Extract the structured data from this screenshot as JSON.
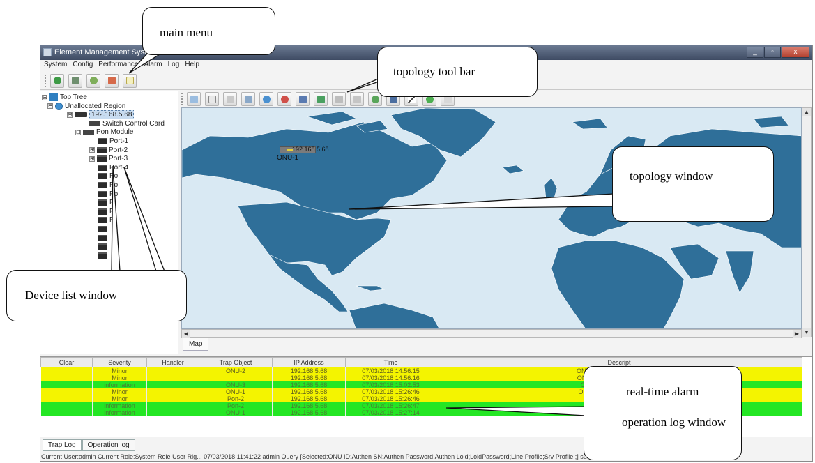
{
  "window": {
    "title": "Element Management System",
    "controls": [
      "_",
      "▫",
      "x"
    ]
  },
  "menu": [
    "System",
    "Config",
    "Performance",
    "Alarm",
    "Log",
    "Help"
  ],
  "tree": [
    {
      "label": "Top Tree",
      "expander": "⊟",
      "icon": "top-tree-icon"
    },
    {
      "label": "Unallocated Region",
      "expander": "⊟",
      "icon": "globe-icon"
    },
    {
      "label": "192.168.5.68",
      "expander": "⊟",
      "icon": "olt-device-icon",
      "selected": true
    },
    {
      "label": "Switch Control Card",
      "expander": "",
      "icon": "card-icon"
    },
    {
      "label": "Pon Module",
      "expander": "⊟",
      "icon": "card-icon"
    },
    {
      "label": "Port-1",
      "expander": "",
      "icon": "port-icon"
    },
    {
      "label": "Port-2",
      "expander": "⊞",
      "icon": "port-icon"
    },
    {
      "label": "Port-3",
      "expander": "⊞",
      "icon": "port-icon"
    },
    {
      "label": "Port-4",
      "expander": "",
      "icon": "port-icon"
    },
    {
      "label": "Po",
      "expander": "",
      "icon": "port-icon"
    },
    {
      "label": "Po",
      "expander": "",
      "icon": "port-icon"
    },
    {
      "label": "Po",
      "expander": "",
      "icon": "port-icon"
    },
    {
      "label": "P",
      "expander": "",
      "icon": "port-icon"
    },
    {
      "label": "P",
      "expander": "",
      "icon": "port-icon"
    },
    {
      "label": "P",
      "expander": "",
      "icon": "port-icon"
    },
    {
      "label": "",
      "expander": "",
      "icon": "port-icon"
    },
    {
      "label": "",
      "expander": "",
      "icon": "port-icon"
    },
    {
      "label": "",
      "expander": "",
      "icon": "port-icon"
    },
    {
      "label": "",
      "expander": "",
      "icon": "port-icon"
    }
  ],
  "topology": {
    "device_ip": "192.168.5.68",
    "device_label": "ONU-1",
    "tab": "Map"
  },
  "alarm_table": {
    "columns": [
      "Clear",
      "Severity",
      "Handler",
      "Trap Object",
      "IP Address",
      "Time",
      "Descript"
    ],
    "rows": [
      {
        "color": "yellow",
        "cells": [
          "",
          "Minor",
          "",
          "ONU-2",
          "192.168.5.68",
          "07/03/2018 14:56:15",
          "ONU DeRegistered(PON Card"
        ]
      },
      {
        "color": "yellow",
        "cells": [
          "",
          "Minor",
          "",
          "",
          "192.168.5.68",
          "07/03/2018 14:56:16",
          "ONU loss Of frame(PON Card"
        ]
      },
      {
        "color": "green",
        "cells": [
          "",
          "information",
          "",
          "ONU-3",
          "192.168.5.68",
          "07/03/2018 15:02:53",
          "ONU Registered(PON Card"
        ]
      },
      {
        "color": "yellow",
        "cells": [
          "",
          "Minor",
          "",
          "ONU-1",
          "192.168.5.68",
          "07/03/2018 15:26:46",
          "ONU DeRegistered(PON Car"
        ]
      },
      {
        "color": "yellow",
        "cells": [
          "",
          "Minor",
          "",
          "Pon-2",
          "192.168.5.68",
          "07/03/2018 15:26:46",
          ""
        ]
      },
      {
        "color": "green",
        "cells": [
          "",
          "information",
          "",
          "Pon-2",
          "192.168.5.68",
          "07/03/2018 15:26:47",
          ""
        ]
      },
      {
        "color": "green",
        "cells": [
          "",
          "information",
          "",
          "ONU-1",
          "192.168.5.68",
          "07/03/2018 15:27:14",
          "ONU Registered(PON Car"
        ]
      }
    ]
  },
  "bottom_tabs": [
    "Trap Log",
    "Operation log"
  ],
  "status_bar": "Current User:admin Current Role:System Role User Rig...     07/03/2018 11:41:22  admin  Query [Selected:ONU ID;Authen SN;Authen Password;Authen Loid;LoidPassword;Line Profile;Srv Profile   ;] success; Device: Top Tree->Unallocated Regio...",
  "callouts": {
    "main_menu": "main menu",
    "topology_tool_bar": "topology tool bar",
    "topology_window": "topology window",
    "device_list_window": "Device list window",
    "realtime_alarm": "real-time alarm",
    "operation_log_window": "operation log window"
  },
  "colors": {
    "ocean": "#d9e9f3",
    "land": "#2f6f99",
    "alarm_yellow": "#f4f400",
    "alarm_green": "#24e624"
  }
}
